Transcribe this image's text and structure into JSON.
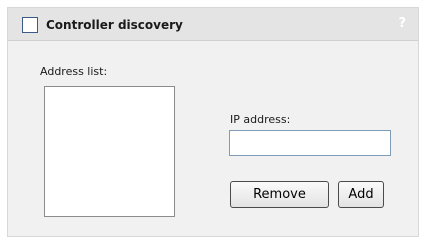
{
  "panel": {
    "title": "Controller discovery",
    "checkbox_checked": false,
    "help_icon": "?",
    "help_icon_name": "question-mark-icon"
  },
  "address_list": {
    "label": "Address list:",
    "items": []
  },
  "ip_address": {
    "label": "IP address:",
    "value": "",
    "placeholder": ""
  },
  "buttons": {
    "remove_label": "Remove",
    "add_label": "Add"
  },
  "colors": {
    "header_bg": "#e4e4e4",
    "panel_bg": "#f1f1f1",
    "checkbox_border": "#3b5a86",
    "input_border": "#7f9db9"
  }
}
